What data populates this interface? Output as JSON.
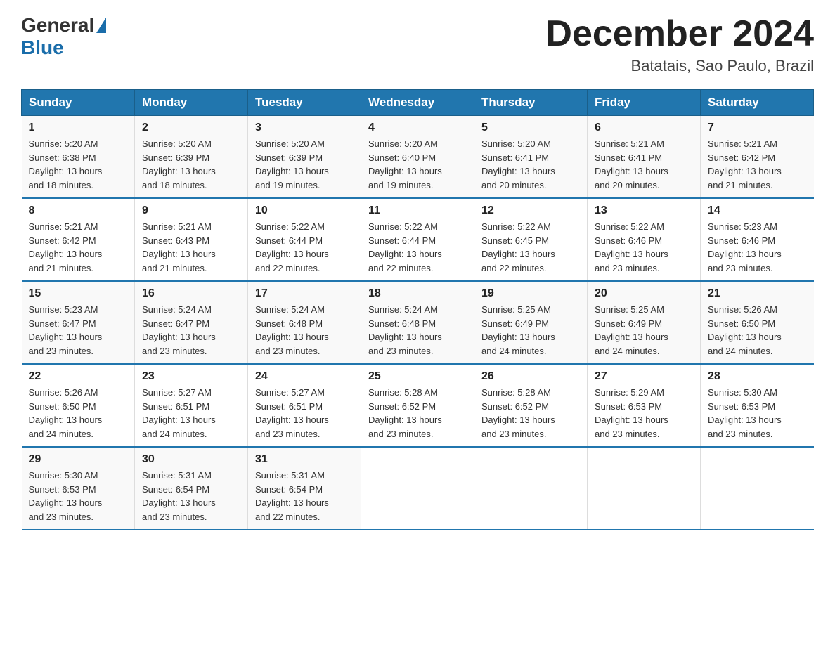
{
  "logo": {
    "general": "General",
    "triangle": "",
    "blue": "Blue"
  },
  "title": "December 2024",
  "subtitle": "Batatais, Sao Paulo, Brazil",
  "headers": [
    "Sunday",
    "Monday",
    "Tuesday",
    "Wednesday",
    "Thursday",
    "Friday",
    "Saturday"
  ],
  "weeks": [
    [
      {
        "day": "1",
        "sunrise": "5:20 AM",
        "sunset": "6:38 PM",
        "daylight": "13 hours and 18 minutes."
      },
      {
        "day": "2",
        "sunrise": "5:20 AM",
        "sunset": "6:39 PM",
        "daylight": "13 hours and 18 minutes."
      },
      {
        "day": "3",
        "sunrise": "5:20 AM",
        "sunset": "6:39 PM",
        "daylight": "13 hours and 19 minutes."
      },
      {
        "day": "4",
        "sunrise": "5:20 AM",
        "sunset": "6:40 PM",
        "daylight": "13 hours and 19 minutes."
      },
      {
        "day": "5",
        "sunrise": "5:20 AM",
        "sunset": "6:41 PM",
        "daylight": "13 hours and 20 minutes."
      },
      {
        "day": "6",
        "sunrise": "5:21 AM",
        "sunset": "6:41 PM",
        "daylight": "13 hours and 20 minutes."
      },
      {
        "day": "7",
        "sunrise": "5:21 AM",
        "sunset": "6:42 PM",
        "daylight": "13 hours and 21 minutes."
      }
    ],
    [
      {
        "day": "8",
        "sunrise": "5:21 AM",
        "sunset": "6:42 PM",
        "daylight": "13 hours and 21 minutes."
      },
      {
        "day": "9",
        "sunrise": "5:21 AM",
        "sunset": "6:43 PM",
        "daylight": "13 hours and 21 minutes."
      },
      {
        "day": "10",
        "sunrise": "5:22 AM",
        "sunset": "6:44 PM",
        "daylight": "13 hours and 22 minutes."
      },
      {
        "day": "11",
        "sunrise": "5:22 AM",
        "sunset": "6:44 PM",
        "daylight": "13 hours and 22 minutes."
      },
      {
        "day": "12",
        "sunrise": "5:22 AM",
        "sunset": "6:45 PM",
        "daylight": "13 hours and 22 minutes."
      },
      {
        "day": "13",
        "sunrise": "5:22 AM",
        "sunset": "6:46 PM",
        "daylight": "13 hours and 23 minutes."
      },
      {
        "day": "14",
        "sunrise": "5:23 AM",
        "sunset": "6:46 PM",
        "daylight": "13 hours and 23 minutes."
      }
    ],
    [
      {
        "day": "15",
        "sunrise": "5:23 AM",
        "sunset": "6:47 PM",
        "daylight": "13 hours and 23 minutes."
      },
      {
        "day": "16",
        "sunrise": "5:24 AM",
        "sunset": "6:47 PM",
        "daylight": "13 hours and 23 minutes."
      },
      {
        "day": "17",
        "sunrise": "5:24 AM",
        "sunset": "6:48 PM",
        "daylight": "13 hours and 23 minutes."
      },
      {
        "day": "18",
        "sunrise": "5:24 AM",
        "sunset": "6:48 PM",
        "daylight": "13 hours and 23 minutes."
      },
      {
        "day": "19",
        "sunrise": "5:25 AM",
        "sunset": "6:49 PM",
        "daylight": "13 hours and 24 minutes."
      },
      {
        "day": "20",
        "sunrise": "5:25 AM",
        "sunset": "6:49 PM",
        "daylight": "13 hours and 24 minutes."
      },
      {
        "day": "21",
        "sunrise": "5:26 AM",
        "sunset": "6:50 PM",
        "daylight": "13 hours and 24 minutes."
      }
    ],
    [
      {
        "day": "22",
        "sunrise": "5:26 AM",
        "sunset": "6:50 PM",
        "daylight": "13 hours and 24 minutes."
      },
      {
        "day": "23",
        "sunrise": "5:27 AM",
        "sunset": "6:51 PM",
        "daylight": "13 hours and 24 minutes."
      },
      {
        "day": "24",
        "sunrise": "5:27 AM",
        "sunset": "6:51 PM",
        "daylight": "13 hours and 23 minutes."
      },
      {
        "day": "25",
        "sunrise": "5:28 AM",
        "sunset": "6:52 PM",
        "daylight": "13 hours and 23 minutes."
      },
      {
        "day": "26",
        "sunrise": "5:28 AM",
        "sunset": "6:52 PM",
        "daylight": "13 hours and 23 minutes."
      },
      {
        "day": "27",
        "sunrise": "5:29 AM",
        "sunset": "6:53 PM",
        "daylight": "13 hours and 23 minutes."
      },
      {
        "day": "28",
        "sunrise": "5:30 AM",
        "sunset": "6:53 PM",
        "daylight": "13 hours and 23 minutes."
      }
    ],
    [
      {
        "day": "29",
        "sunrise": "5:30 AM",
        "sunset": "6:53 PM",
        "daylight": "13 hours and 23 minutes."
      },
      {
        "day": "30",
        "sunrise": "5:31 AM",
        "sunset": "6:54 PM",
        "daylight": "13 hours and 23 minutes."
      },
      {
        "day": "31",
        "sunrise": "5:31 AM",
        "sunset": "6:54 PM",
        "daylight": "13 hours and 22 minutes."
      },
      null,
      null,
      null,
      null
    ]
  ],
  "labels": {
    "sunrise": "Sunrise:",
    "sunset": "Sunset:",
    "daylight": "Daylight:"
  }
}
